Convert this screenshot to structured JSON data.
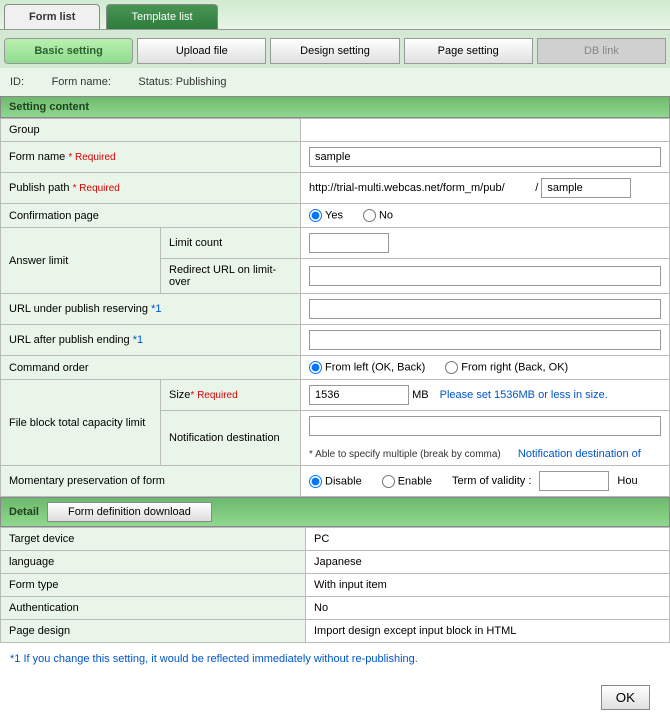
{
  "topTabs": {
    "formList": "Form list",
    "templateList": "Template list"
  },
  "subTabs": {
    "basic": "Basic setting",
    "upload": "Upload file",
    "design": "Design setting",
    "page": "Page setting",
    "db": "DB link"
  },
  "info": {
    "idLabel": "ID:",
    "formNameLabel": "Form name:",
    "statusLabel": "Status:",
    "statusValue": "Publishing"
  },
  "section": {
    "content": "Setting content",
    "detail": "Detail"
  },
  "rows": {
    "group": "Group",
    "formName": "Form name",
    "publishPath": "Publish path",
    "publishPathPrefix": "http://trial-multi.webcas.net/form_m/pub/",
    "publishPathValue": "sample",
    "confirmPage": "Confirmation page",
    "answerLimit": "Answer limit",
    "limitCount": "Limit count",
    "redirectUrl": "Redirect URL on limit-over",
    "urlReserving": "URL under publish reserving",
    "urlEnding": "URL after publish ending",
    "commandOrder": "Command order",
    "fileBlock": "File block total capacity limit",
    "size": "Size",
    "sizeValue": "1536",
    "sizeUnit": "MB",
    "sizeHint": "Please set 1536MB or less in size.",
    "notifDest": "Notification destination",
    "notifNote": "* Able to specify multiple (break by comma)",
    "notifLink": "Notification destination of",
    "momentary": "Momentary preservation of form",
    "termValidity": "Term of validity :",
    "termUnit": "Hou",
    "formNameValue": "sample"
  },
  "required": "* Required",
  "ref1": "*1",
  "radios": {
    "yes": "Yes",
    "no": "No",
    "fromLeft": "From left (OK, Back)",
    "fromRight": "From right (Back, OK)",
    "disable": "Disable",
    "enable": "Enable"
  },
  "detail": {
    "downloadBtn": "Form definition download",
    "targetDevice": "Target device",
    "targetDeviceVal": "PC",
    "language": "language",
    "languageVal": "Japanese",
    "formType": "Form type",
    "formTypeVal": "With input item",
    "auth": "Authentication",
    "authVal": "No",
    "pageDesign": "Page design",
    "pageDesignVal": "Import design except input block in HTML"
  },
  "footnote": "*1 If you change this setting, it would be reflected immediately without re-publishing.",
  "ok": "OK"
}
